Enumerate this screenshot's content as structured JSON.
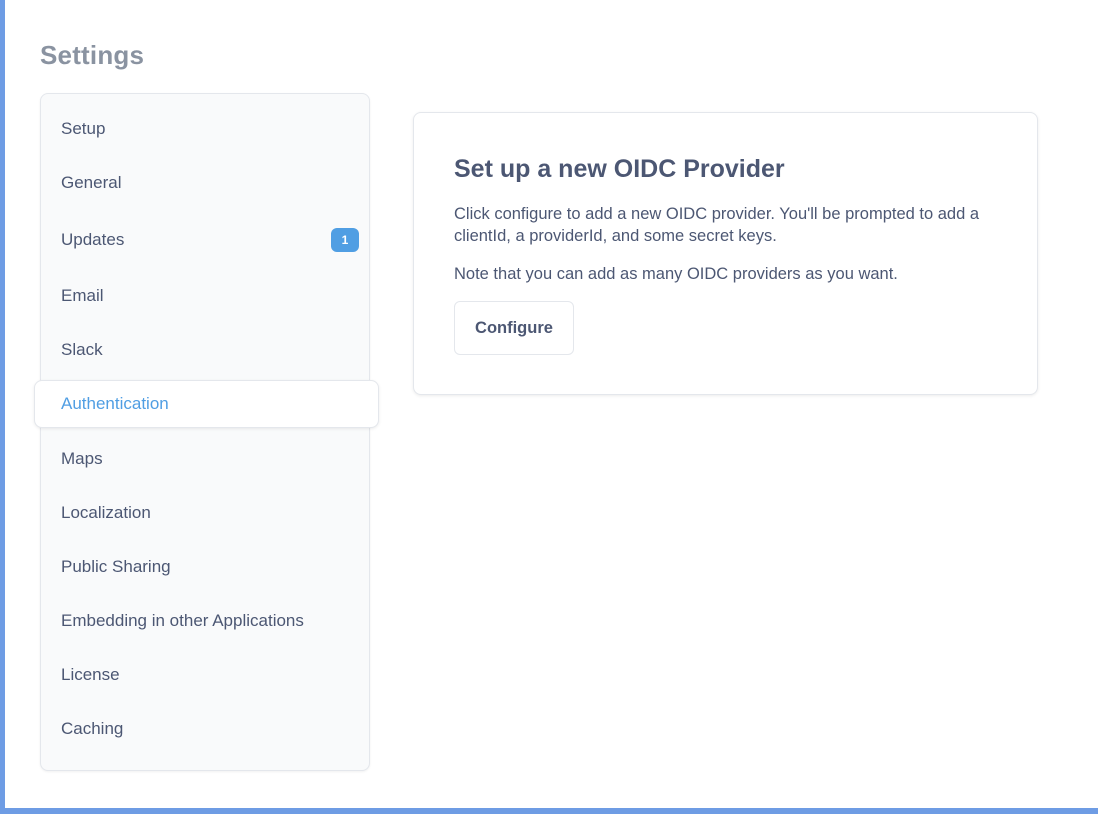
{
  "page": {
    "title": "Settings"
  },
  "sidebar": {
    "items": [
      {
        "label": "Setup"
      },
      {
        "label": "General"
      },
      {
        "label": "Updates",
        "badge": "1"
      },
      {
        "label": "Email"
      },
      {
        "label": "Slack"
      },
      {
        "label": "Authentication",
        "active": true
      },
      {
        "label": "Maps"
      },
      {
        "label": "Localization"
      },
      {
        "label": "Public Sharing"
      },
      {
        "label": "Embedding in other Applications"
      },
      {
        "label": "License"
      },
      {
        "label": "Caching"
      }
    ]
  },
  "card": {
    "title": "Set up a new OIDC Provider",
    "description": "Click configure to add a new OIDC provider. You'll be prompted to add a clientId, a providerId, and some secret keys.",
    "note": "Note that you can add as many OIDC providers as you want.",
    "button_label": "Configure"
  },
  "colors": {
    "accent": "#509ee3",
    "text": "#4c5773",
    "muted_title": "#8a93a1",
    "frame": "#6e9ce4"
  }
}
